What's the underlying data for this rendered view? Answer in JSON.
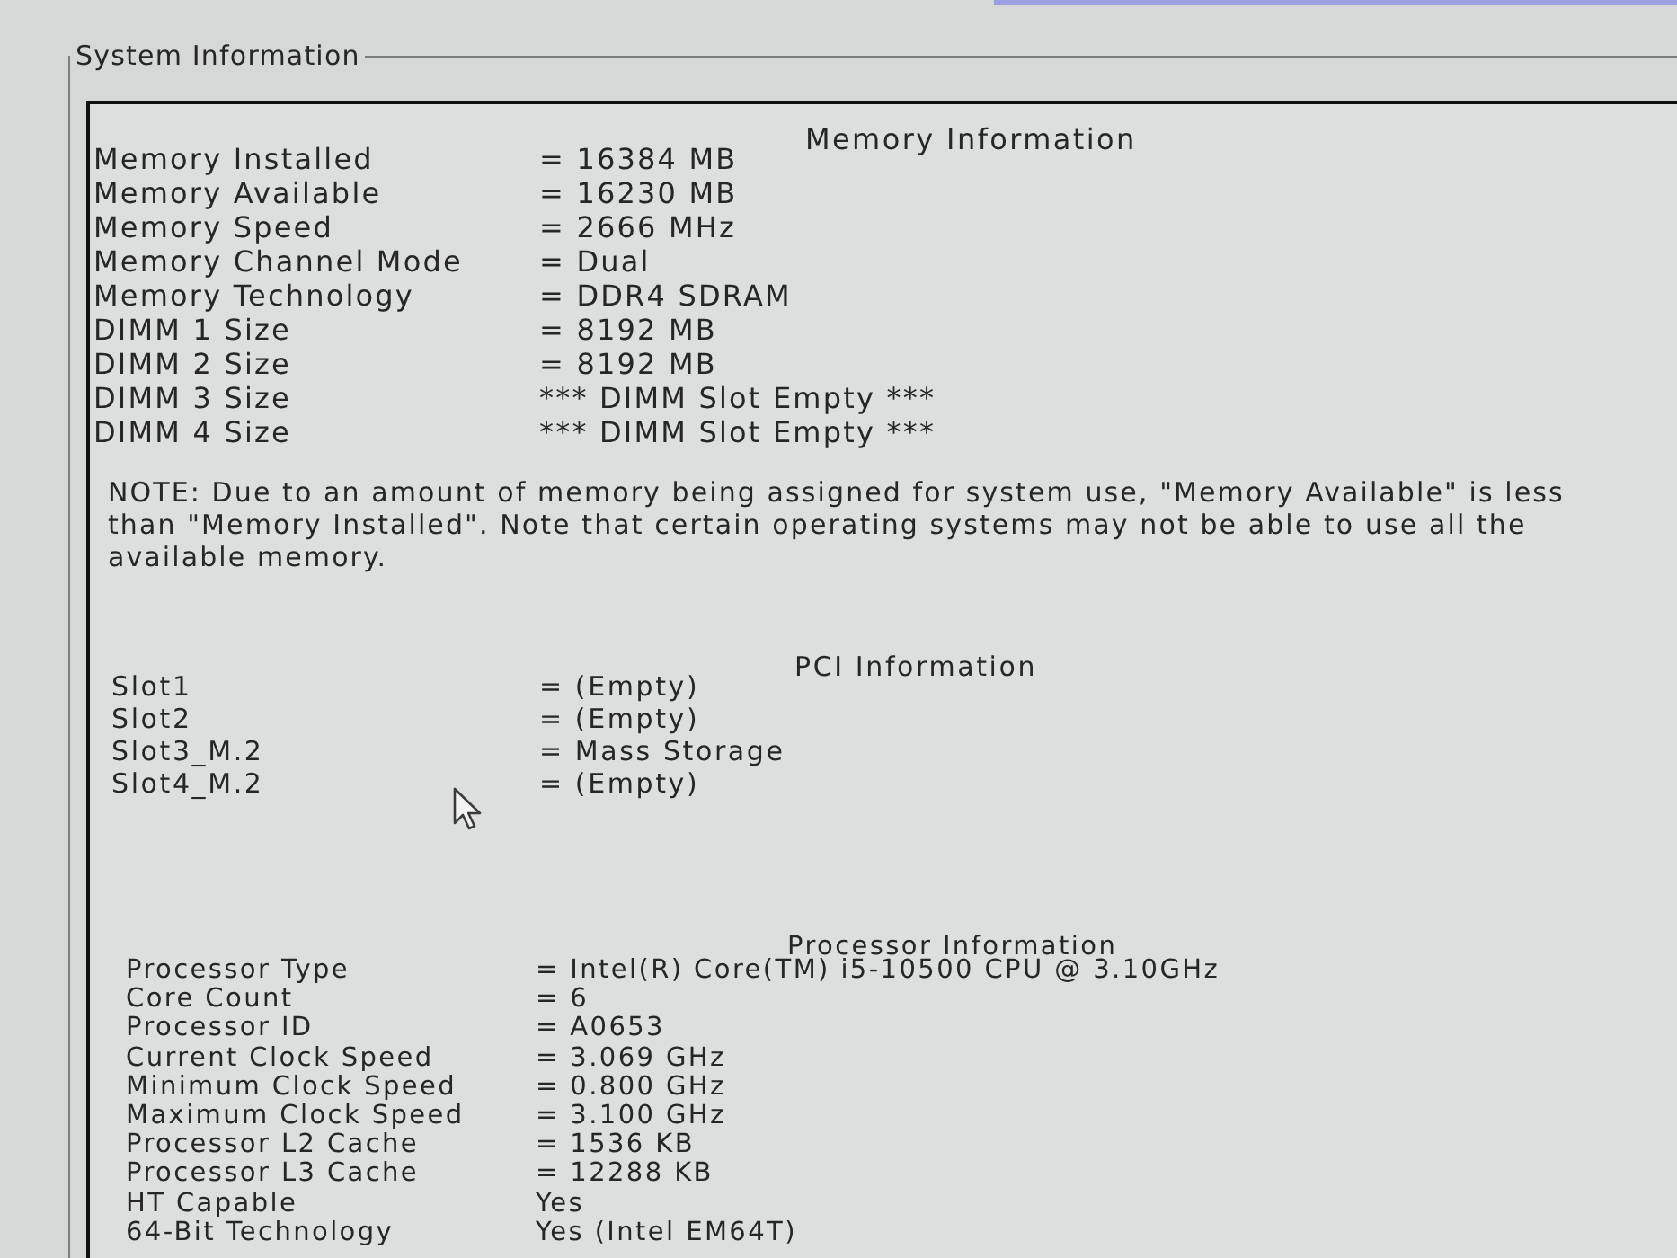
{
  "group": {
    "title": "System Information"
  },
  "memory": {
    "heading": "Memory Information",
    "rows": [
      {
        "label": "Memory Installed",
        "value": "= 16384 MB"
      },
      {
        "label": "Memory Available",
        "value": "= 16230 MB"
      },
      {
        "label": "Memory Speed",
        "value": "= 2666 MHz"
      },
      {
        "label": "Memory Channel Mode",
        "value": "= Dual"
      },
      {
        "label": "Memory Technology",
        "value": "= DDR4 SDRAM"
      },
      {
        "label": "DIMM 1 Size",
        "value": "= 8192 MB"
      },
      {
        "label": "DIMM 2 Size",
        "value": "= 8192 MB"
      },
      {
        "label": "DIMM 3 Size",
        "value": "*** DIMM Slot Empty ***"
      },
      {
        "label": "DIMM 4 Size",
        "value": "*** DIMM Slot Empty ***"
      }
    ]
  },
  "note": "NOTE: Due to an amount of memory being assigned for system use, \"Memory Available\" is less than \"Memory Installed\". Note that certain operating systems may not be able to use all the available memory.",
  "pci": {
    "heading": "PCI Information",
    "rows": [
      {
        "label": "Slot1",
        "value": "= (Empty)"
      },
      {
        "label": "Slot2",
        "value": "= (Empty)"
      },
      {
        "label": "Slot3_M.2",
        "value": "= Mass Storage"
      },
      {
        "label": "Slot4_M.2",
        "value": "= (Empty)"
      }
    ]
  },
  "processor": {
    "heading": "Processor Information",
    "rows": [
      {
        "label": "Processor Type",
        "value": "= Intel(R) Core(TM) i5-10500 CPU @ 3.10GHz"
      },
      {
        "label": "Core Count",
        "value": "= 6"
      },
      {
        "label": "Processor ID",
        "value": "= A0653"
      },
      {
        "label": "Current Clock Speed",
        "value": "= 3.069 GHz"
      },
      {
        "label": "Minimum Clock Speed",
        "value": "= 0.800 GHz"
      },
      {
        "label": "Maximum Clock Speed",
        "value": "= 3.100 GHz"
      },
      {
        "label": "Processor L2 Cache",
        "value": "= 1536 KB"
      },
      {
        "label": "Processor L3 Cache",
        "value": "= 12288 KB"
      },
      {
        "label": "HT Capable",
        "value": "Yes"
      },
      {
        "label": "64-Bit Technology",
        "value": "Yes (Intel EM64T)"
      }
    ]
  }
}
